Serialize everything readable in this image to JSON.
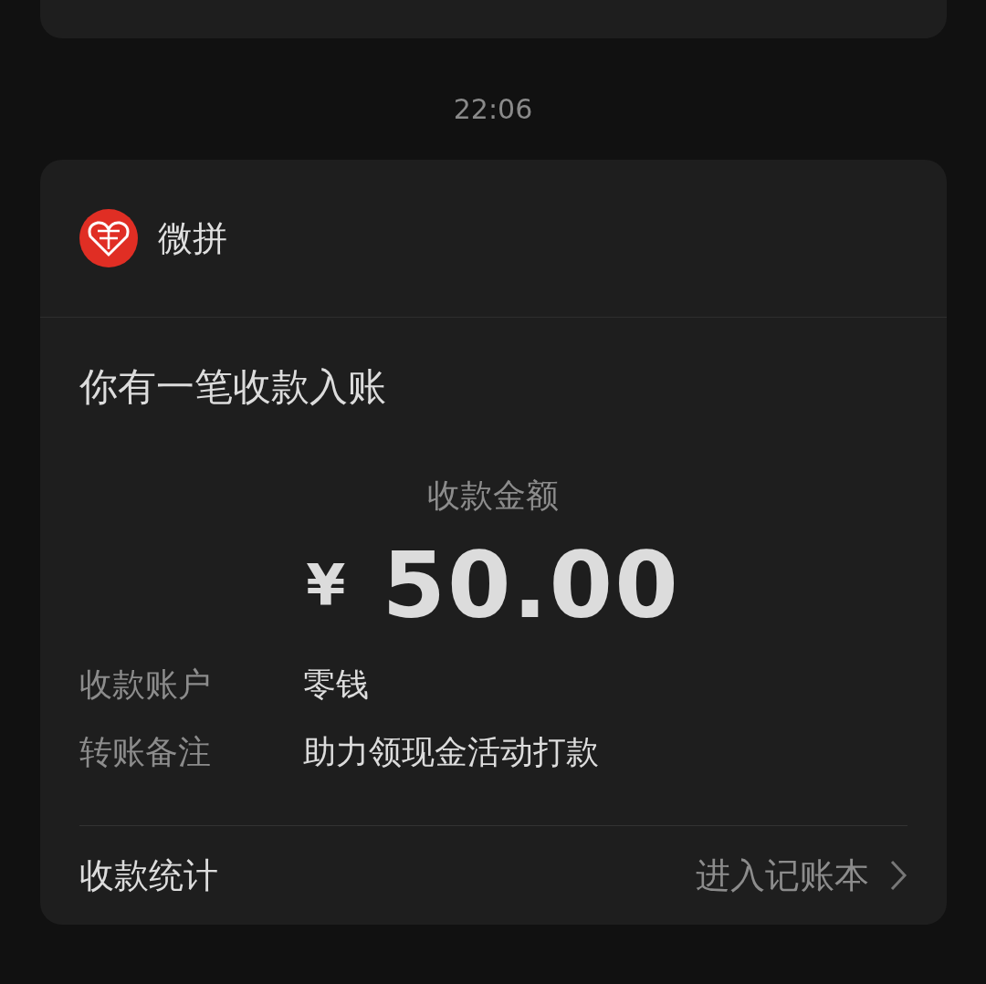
{
  "time": "22:06",
  "card": {
    "sender": "微拼",
    "title": "你有一笔收款入账",
    "amount_label": "收款金额",
    "currency": "¥",
    "amount": "50.00",
    "details": [
      {
        "label": "收款账户",
        "value": "零钱"
      },
      {
        "label": "转账备注",
        "value": "助力领现金活动打款"
      }
    ],
    "footer": {
      "label": "收款统计",
      "link": "进入记账本"
    }
  }
}
